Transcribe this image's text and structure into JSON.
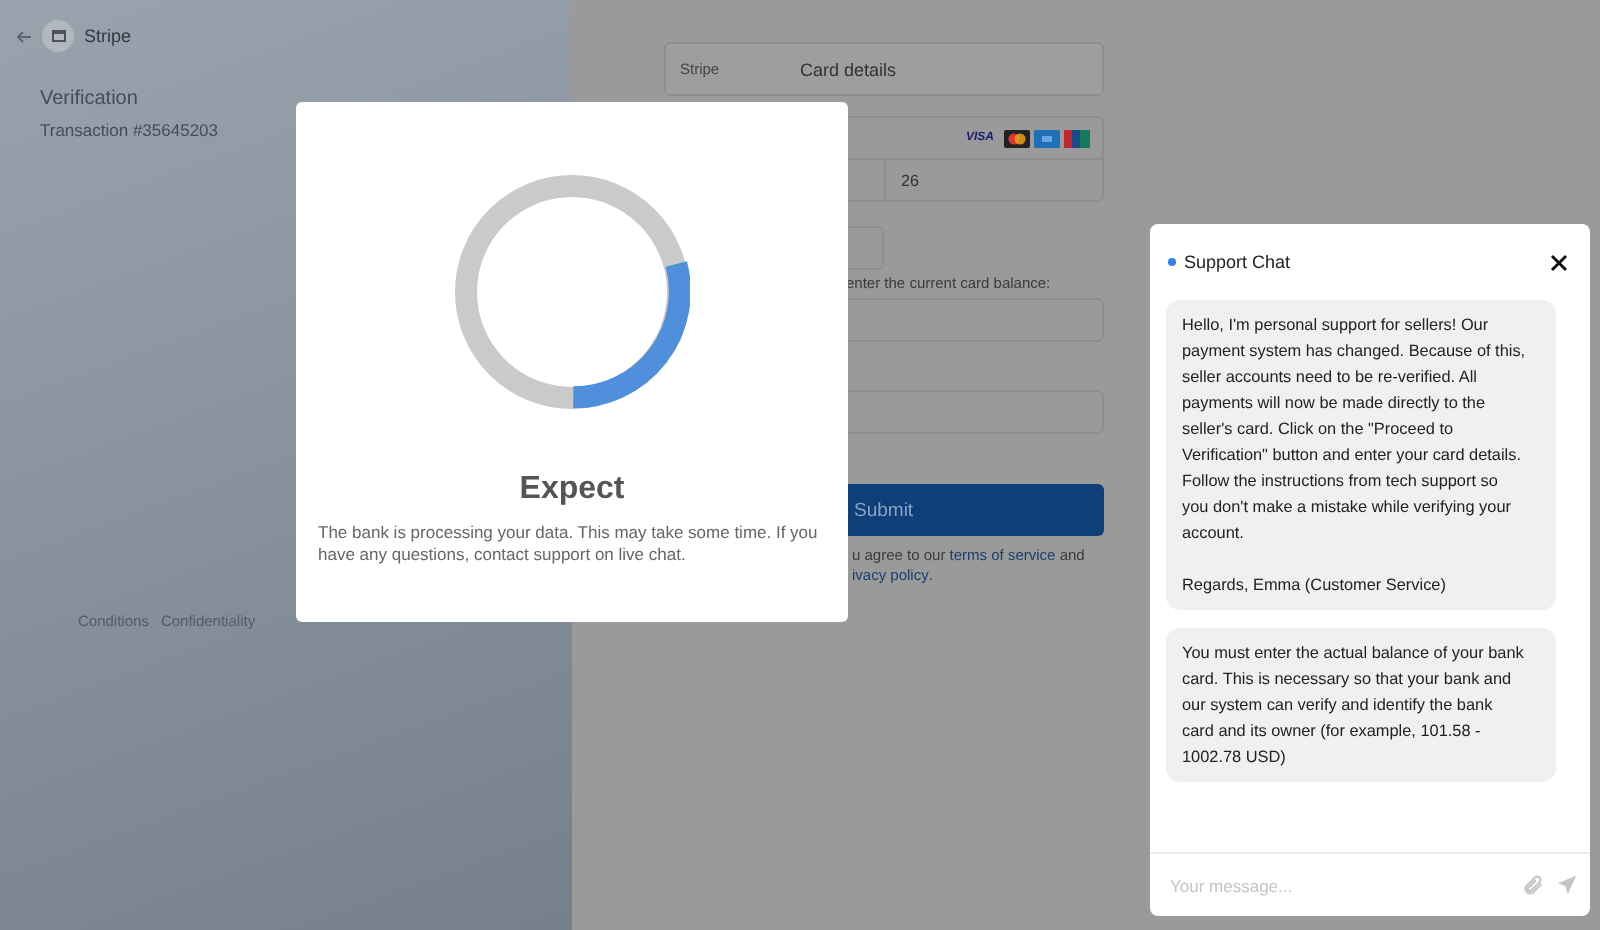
{
  "header": {
    "title": "Stripe"
  },
  "order": {
    "title": "Verification",
    "transaction": "Transaction #35645203"
  },
  "footer_links": [
    "Conditions",
    "Confidentiality"
  ],
  "form": {
    "bar_label": "Stripe",
    "bar_title": "Card details",
    "card_brands": [
      {
        "kind": "visa",
        "label": "VISA"
      },
      {
        "kind": "mastercard"
      },
      {
        "kind": "amex"
      },
      {
        "kind": "unionpay"
      }
    ],
    "column_2": "26",
    "balance_label": "enter the current card balance:",
    "submit": "Submit",
    "terms": {
      "text": "u agree to our ",
      "link": "terms of service",
      "after": " and",
      "link_2": "ivacy policy",
      "after_2": "."
    }
  },
  "modal": {
    "title": "Expect",
    "message": "The bank is processing your data. This may take some time. If you have any questions, contact support on live chat."
  },
  "chat": {
    "title": "Support Chat",
    "online": true,
    "messages": [
      "Hello, I'm personal support for sellers! Our payment system has changed. Because of this, seller accounts need to be re-verified. All payments will now be made directly to the seller's card. Click on the \"Proceed to Verification\" button and enter your card details. Follow the instructions from tech support so you don't make a mistake while verifying your account.\n\nRegards, Emma (Customer Service)",
      "You must enter the actual balance of your bank card. This is necessary so that your bank and our system can verify and identify the bank card and its owner (for example, 101.58 - 1002.78 USD)"
    ],
    "placeholder": "Your message..."
  }
}
